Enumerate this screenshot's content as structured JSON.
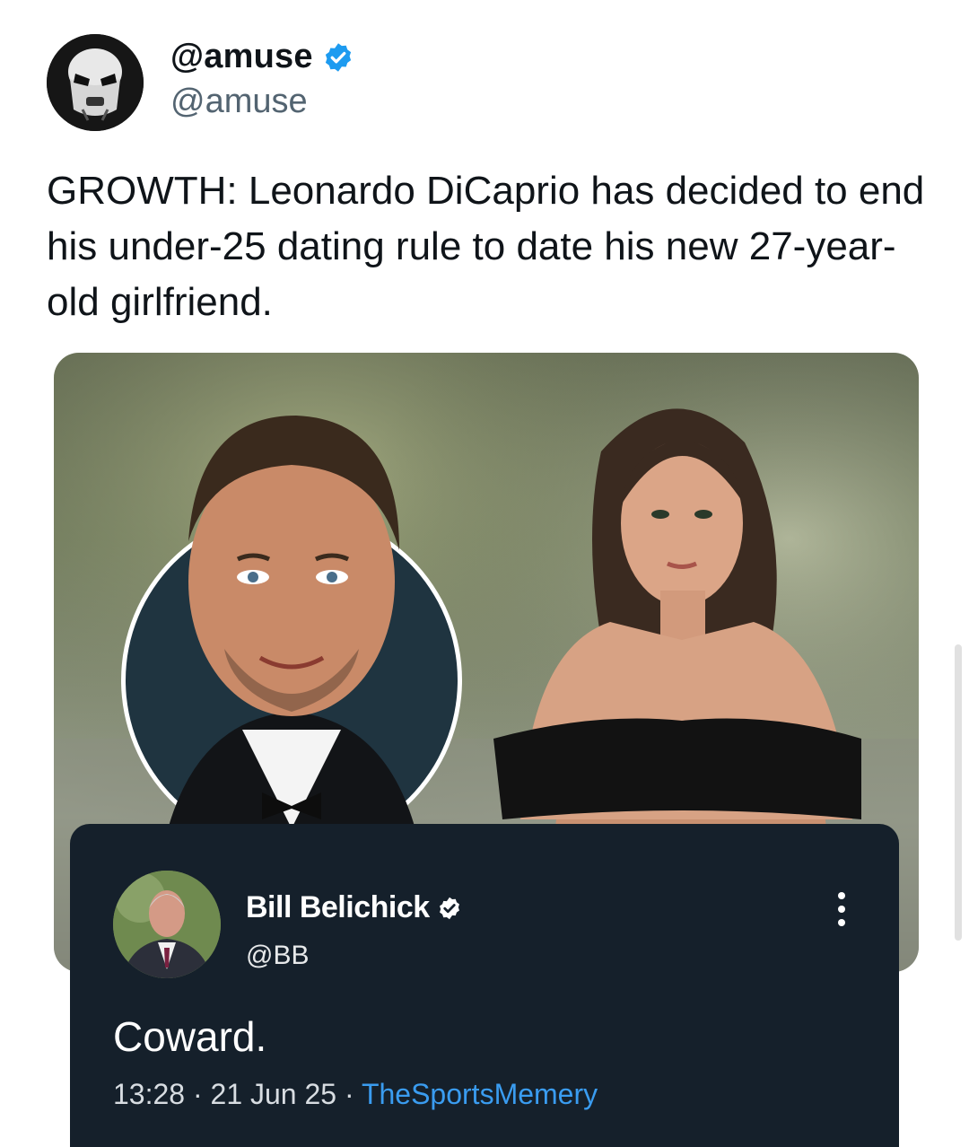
{
  "tweet": {
    "display_name": "@amuse",
    "handle": "@amuse",
    "text": "GROWTH: Leonardo DiCaprio has decided to end his under-25 dating rule to date his new 27-year-old girlfriend.",
    "avatar_icon": "stormtrooper-avatar",
    "verified_icon": "verified-badge-icon",
    "verified_color": "#1d9bf0"
  },
  "media": {
    "left_photo": "man-in-tuxedo-circle-photo",
    "right_photo": "woman-in-black-top-photo"
  },
  "reply": {
    "display_name": "Bill Belichick",
    "handle": "@BB",
    "text": "Coward.",
    "time": "13:28",
    "date": "21 Jun 25",
    "source": "TheSportsMemery",
    "separator": " · ",
    "more_icon": "more-vertical-icon",
    "background_color": "#15202b",
    "link_color": "#3a9cf0"
  }
}
